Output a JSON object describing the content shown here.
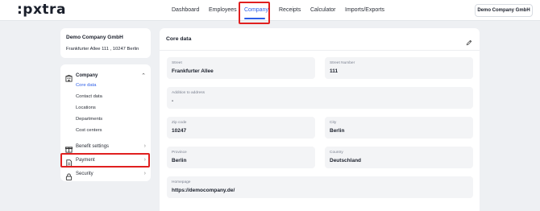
{
  "header": {
    "logo": ":pxtra",
    "nav": [
      {
        "label": "Dashboard",
        "active": false
      },
      {
        "label": "Employees",
        "active": false
      },
      {
        "label": "Company",
        "active": true
      },
      {
        "label": "Receipts",
        "active": false
      },
      {
        "label": "Calculator",
        "active": false
      },
      {
        "label": "Imports/Exports",
        "active": false
      }
    ],
    "company_button": "Demo Company GmbH"
  },
  "sidebar": {
    "company_name": "Demo Company GmbH",
    "company_address": "Frankfurter Allee 111 , 10247 Berlin",
    "section": {
      "label": "Company",
      "icon": "building-icon"
    },
    "sub_items": [
      {
        "label": "Core data",
        "active": true
      },
      {
        "label": "Contact data",
        "active": false
      },
      {
        "label": "Locations",
        "active": false
      },
      {
        "label": "Departments",
        "active": false
      },
      {
        "label": "Cost centers",
        "active": false
      }
    ],
    "items": [
      {
        "label": "Benefit settings",
        "icon": "gift-icon"
      },
      {
        "label": "Payment",
        "icon": "document-icon"
      },
      {
        "label": "Security",
        "icon": "lock-icon"
      }
    ]
  },
  "main": {
    "title": "Core data",
    "fields": {
      "street": {
        "label": "Street",
        "value": "Frankfurter Allee"
      },
      "street_number": {
        "label": "Street Number",
        "value": "111"
      },
      "addition": {
        "label": "Addition to address",
        "value": "-"
      },
      "zip": {
        "label": "Zip code",
        "value": "10247"
      },
      "city": {
        "label": "City",
        "value": "Berlin"
      },
      "province": {
        "label": "Province",
        "value": "Berlin"
      },
      "country": {
        "label": "Country",
        "value": "Deutschland"
      },
      "homepage": {
        "label": "Homepage",
        "value": "https://democompany.de/"
      }
    }
  },
  "colors": {
    "accent": "#2d5ee8",
    "highlight": "#e02020",
    "background": "#eef0f3"
  }
}
